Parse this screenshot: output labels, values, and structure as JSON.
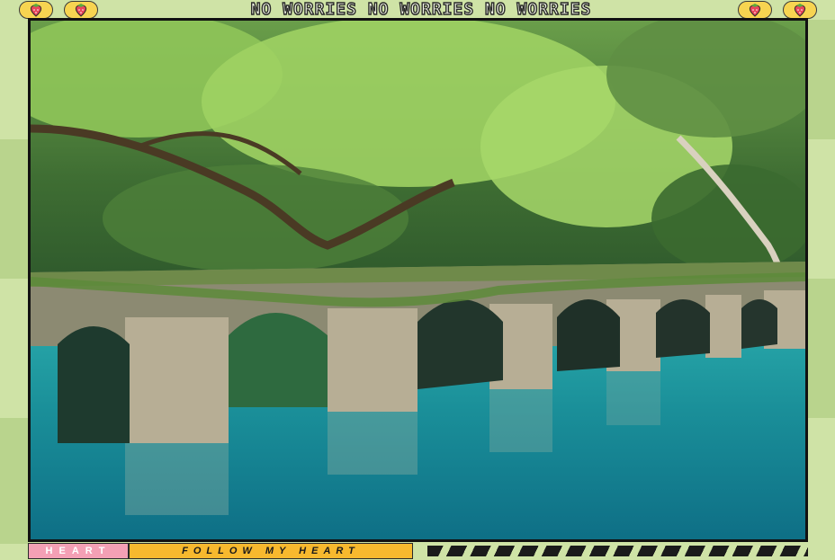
{
  "header": {
    "marquee_text": "NO WORRIES NO WORRIES NO WORRIES",
    "left_icons": [
      "strawberry-icon",
      "strawberry-icon"
    ],
    "right_icons": [
      "strawberry-icon",
      "strawberry-icon"
    ]
  },
  "photo": {
    "subject": "stone-arch-bridge-over-turquoise-river"
  },
  "footer": {
    "heart_tag": "HEART",
    "follow_tag": "FOLLOW MY HEART",
    "stripe_pattern": "diagonal-dashes"
  },
  "colors": {
    "background": "#cfe3a6",
    "heart_tag": "#f4a0b5",
    "follow_tag": "#f7b92e",
    "berry_badge": "#f7d451"
  }
}
